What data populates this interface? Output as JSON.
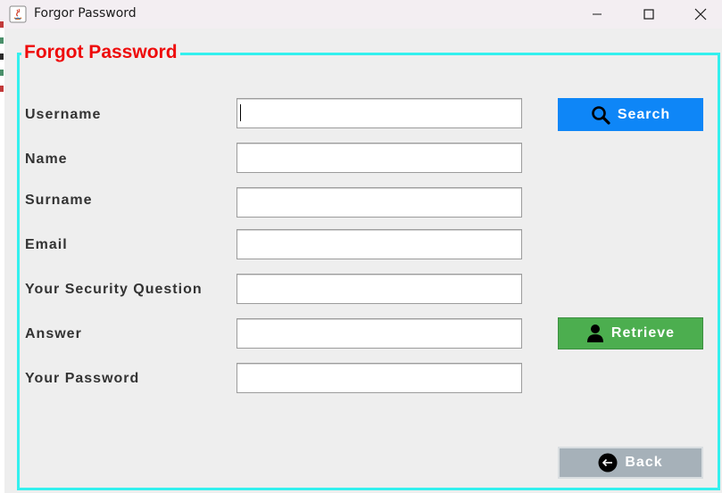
{
  "window": {
    "title": "Forgor Password"
  },
  "panel": {
    "legend": "Forgot Password"
  },
  "form": {
    "fields": [
      {
        "label": "Username",
        "value": ""
      },
      {
        "label": "Name",
        "value": ""
      },
      {
        "label": "Surname",
        "value": ""
      },
      {
        "label": "Email",
        "value": ""
      },
      {
        "label": "Your Security Question",
        "value": ""
      },
      {
        "label": "Answer",
        "value": ""
      },
      {
        "label": "Your Password",
        "value": ""
      }
    ]
  },
  "buttons": {
    "search": {
      "label": "Search",
      "icon": "search-icon",
      "color": "#0e86f7"
    },
    "retrieve": {
      "label": "Retrieve",
      "icon": "user-icon",
      "color": "#4cae4f"
    },
    "back": {
      "label": "Back",
      "icon": "back-arrow-icon",
      "color": "#a6b1b9"
    }
  },
  "colors": {
    "legend": "#ee0b0b",
    "panel_border": "#33f0ee",
    "background": "#eeeeee"
  }
}
